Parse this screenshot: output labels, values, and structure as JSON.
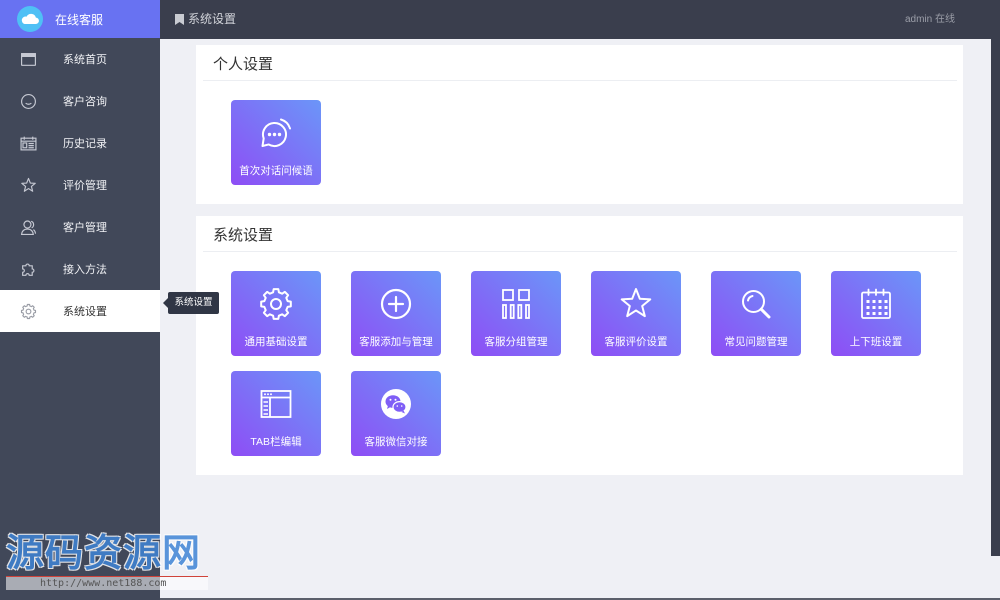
{
  "app": {
    "title": "在线客服",
    "logo_icon": "cloud-icon"
  },
  "header": {
    "page_title": "系统设置",
    "page_icon": "bookmark-icon",
    "user": "admin",
    "status": "在线"
  },
  "sidebar": {
    "items": [
      {
        "label": "系统首页",
        "icon": "window-icon",
        "active": false
      },
      {
        "label": "客户咨询",
        "icon": "smile-icon",
        "active": false
      },
      {
        "label": "历史记录",
        "icon": "history-icon",
        "active": false
      },
      {
        "label": "评价管理",
        "icon": "star-icon",
        "active": false
      },
      {
        "label": "客户管理",
        "icon": "user-icon",
        "active": false
      },
      {
        "label": "接入方法",
        "icon": "puzzle-icon",
        "active": false
      },
      {
        "label": "系统设置",
        "icon": "gear-icon",
        "active": true
      }
    ]
  },
  "tooltip": {
    "text": "系统设置"
  },
  "sections": [
    {
      "title": "个人设置",
      "tiles": [
        {
          "label": "首次对话问候语",
          "icon": "chat-bubble-icon"
        }
      ]
    },
    {
      "title": "系统设置",
      "tiles": [
        {
          "label": "通用基础设置",
          "icon": "gear-icon"
        },
        {
          "label": "客服添加与管理",
          "icon": "plus-circle-icon"
        },
        {
          "label": "客服分组管理",
          "icon": "group-grid-icon"
        },
        {
          "label": "客服评价设置",
          "icon": "star-icon"
        },
        {
          "label": "常见问题管理",
          "icon": "search-icon"
        },
        {
          "label": "上下班设置",
          "icon": "calendar-icon"
        },
        {
          "label": "TAB栏编辑",
          "icon": "tab-window-icon"
        },
        {
          "label": "客服微信对接",
          "icon": "wechat-icon"
        }
      ]
    }
  ],
  "watermark": {
    "text": "源码资源网",
    "url": "http://www.net188.com"
  },
  "colors": {
    "sidebar_bg": "#414859",
    "logo_bg": "#6872f2",
    "header_bg": "#3a3e4d",
    "page_bg": "#eff0f5",
    "tile_start": "#8e4df5",
    "tile_end": "#6b96f8",
    "tooltip_bg": "#303645"
  }
}
